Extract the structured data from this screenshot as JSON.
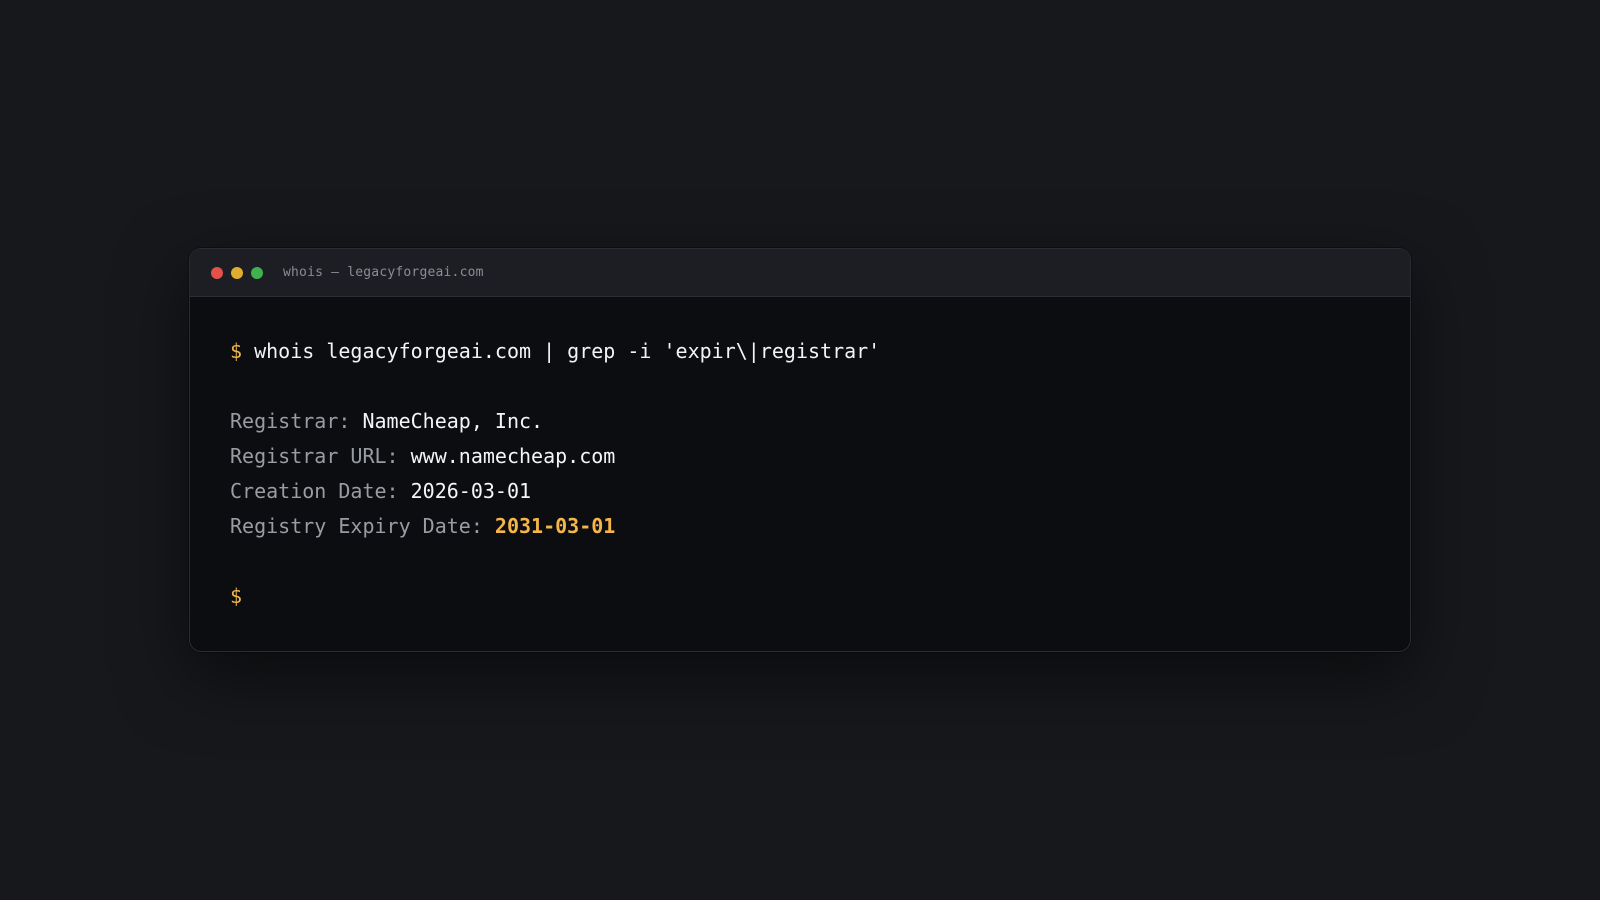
{
  "window": {
    "title": "whois — legacyforgeai.com"
  },
  "terminal": {
    "prompt": "$",
    "command": "whois legacyforgeai.com | grep -i 'expir\\|registrar'",
    "output": [
      {
        "key": "Registrar:",
        "value": "NameCheap, Inc."
      },
      {
        "key": "Registrar URL:",
        "value": "www.namecheap.com"
      },
      {
        "key": "Creation Date:",
        "value": "2026-03-01"
      },
      {
        "key": "Registry Expiry Date:",
        "value": "2031-03-01"
      }
    ],
    "final_prompt": "$"
  },
  "colors": {
    "background": "#17181c",
    "terminal_bg": "#0c0d10",
    "titlebar_bg": "#1c1e23",
    "prompt": "#f0b44a",
    "highlight": "#f5b54a",
    "key_text": "#9a9ca4",
    "value_text": "#f4f5f7",
    "close": "#e2524a",
    "minimize": "#e0ad2e",
    "maximize": "#3fb24f"
  }
}
